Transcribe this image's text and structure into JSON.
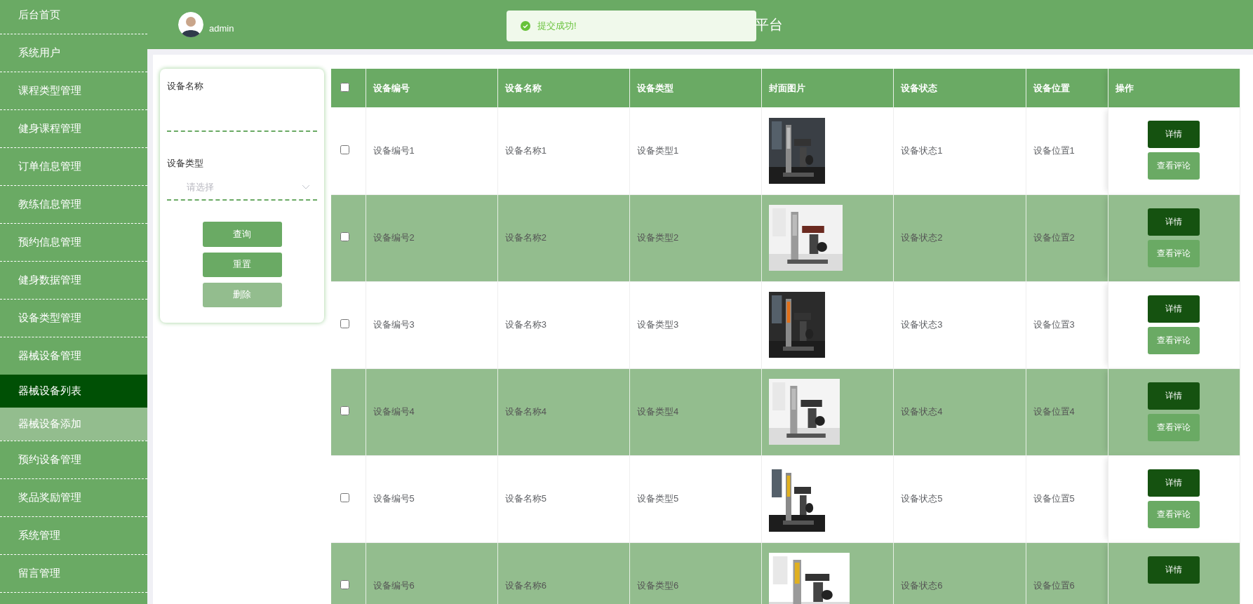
{
  "sidebar": {
    "items": [
      {
        "label": "后台首页",
        "selected": false
      },
      {
        "label": "系统用户",
        "selected": false
      },
      {
        "label": "课程类型管理",
        "selected": false
      },
      {
        "label": "健身课程管理",
        "selected": false
      },
      {
        "label": "订单信息管理",
        "selected": false
      },
      {
        "label": "教练信息管理",
        "selected": false
      },
      {
        "label": "预约信息管理",
        "selected": false
      },
      {
        "label": "健身数据管理",
        "selected": false
      },
      {
        "label": "设备类型管理",
        "selected": false
      },
      {
        "label": "器械设备管理",
        "selected": false,
        "children": [
          {
            "label": "器械设备列表",
            "selected": true
          },
          {
            "label": "器械设备添加",
            "selected": false
          }
        ]
      },
      {
        "label": "预约设备管理",
        "selected": false
      },
      {
        "label": "奖品奖励管理",
        "selected": false
      },
      {
        "label": "系统管理",
        "selected": false
      },
      {
        "label": "留言管理",
        "selected": false
      }
    ]
  },
  "header": {
    "user": "admin",
    "title": "平台"
  },
  "toast": {
    "message": "提交成功!"
  },
  "search": {
    "fields": [
      {
        "kind": "text",
        "label": "设备名称"
      },
      {
        "kind": "select",
        "label": "设备类型",
        "placeholder": "请选择"
      }
    ],
    "buttons": [
      {
        "label": "查询",
        "disabled": false
      },
      {
        "label": "重置",
        "disabled": false
      },
      {
        "label": "删除",
        "disabled": true
      }
    ]
  },
  "table": {
    "all_checked": false,
    "columns": [
      "设备编号",
      "设备名称",
      "设备类型",
      "封面图片",
      "设备状态",
      "设备位置",
      "操作"
    ],
    "rows": [
      {
        "checked": false,
        "cells": [
          "设备编号1",
          "设备名称1",
          "设备类型1",
          {
            "kind": "picture"
          },
          "设备状态1",
          "设备位置1"
        ],
        "actions": [
          "详情",
          "查看评论"
        ]
      },
      {
        "checked": false,
        "cells": [
          "设备编号2",
          "设备名称2",
          "设备类型2",
          {
            "kind": "picture"
          },
          "设备状态2",
          "设备位置2"
        ],
        "actions": [
          "详情",
          "查看评论"
        ]
      },
      {
        "checked": false,
        "cells": [
          "设备编号3",
          "设备名称3",
          "设备类型3",
          {
            "kind": "picture"
          },
          "设备状态3",
          "设备位置3"
        ],
        "actions": [
          "详情",
          "查看评论"
        ]
      },
      {
        "checked": false,
        "cells": [
          "设备编号4",
          "设备名称4",
          "设备类型4",
          {
            "kind": "picture"
          },
          "设备状态4",
          "设备位置4"
        ],
        "actions": [
          "详情",
          "查看评论"
        ]
      },
      {
        "checked": false,
        "cells": [
          "设备编号5",
          "设备名称5",
          "设备类型5",
          {
            "kind": "picture"
          },
          "设备状态5",
          "设备位置5"
        ],
        "actions": [
          "详情",
          "查看评论"
        ]
      },
      {
        "checked": false,
        "cells": [
          "设备编号6",
          "设备名称6",
          "设备类型6",
          {
            "kind": "picture"
          },
          "设备状态6",
          "设备位置6"
        ],
        "actions": [
          "详情"
        ]
      }
    ]
  }
}
